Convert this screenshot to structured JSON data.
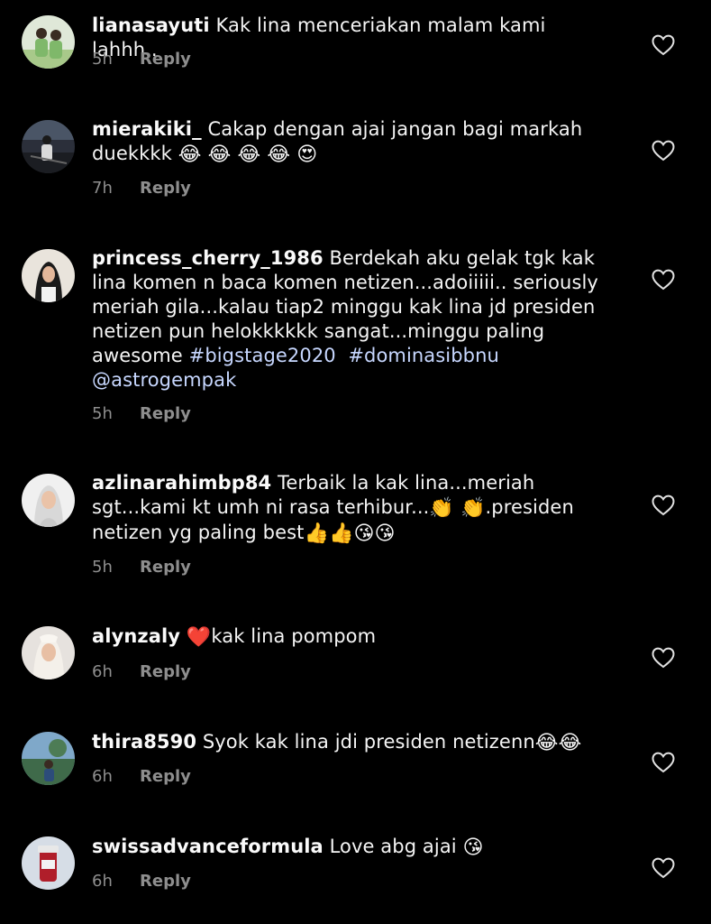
{
  "comments": [
    {
      "username": "lianasayuti",
      "text": "Kak lina menceriakan malam kami lahhh..",
      "time": "5h",
      "reply_label": "Reply"
    },
    {
      "username": "mierakiki_",
      "text": "Cakap dengan ajai jangan bagi markah duekkkk",
      "emojis": "😂 😂 😂 😂 😍",
      "time": "7h",
      "reply_label": "Reply"
    },
    {
      "username": "princess_cherry_1986",
      "text": "Berdekah aku gelak tgk kak lina komen n baca komen netizen...adoiiiii.. seriously meriah gila...kalau tiap2 minggu kak lina jd presiden netizen pun helokkkkkk sangat...minggu paling awesome",
      "hashtag_1": "#bigstage2020",
      "hashtag_2": "#dominasibbnu",
      "mention": "@astrogempak",
      "time": "5h",
      "reply_label": "Reply"
    },
    {
      "username": "azlinarahimbp84",
      "text_1": "Terbaik la kak lina...meriah sgt...kami kt umh ni rasa terhibur...",
      "clap_emojis": "👏 👏",
      "text_2": ".presiden netizen yg paling best",
      "end_emojis": "👍👍😘😘",
      "time": "5h",
      "reply_label": "Reply"
    },
    {
      "username": "alynzaly",
      "heart_emoji": "❤️",
      "text": "kak lina pompom",
      "time": "6h",
      "reply_label": "Reply"
    },
    {
      "username": "thira8590",
      "text": "Syok kak lina jdi presiden netizenn",
      "emojis": "😂😂",
      "time": "6h",
      "reply_label": "Reply"
    },
    {
      "username": "swissadvanceformula",
      "text": "Love abg ajai",
      "emojis": "😘",
      "time": "6h",
      "reply_label": "Reply"
    }
  ],
  "colors": {
    "background": "#000000",
    "text": "#f5f5f5",
    "meta": "#8e8e8e",
    "hashtag": "#c7d7ff"
  },
  "icons": {
    "like": "heart-outline-icon"
  }
}
